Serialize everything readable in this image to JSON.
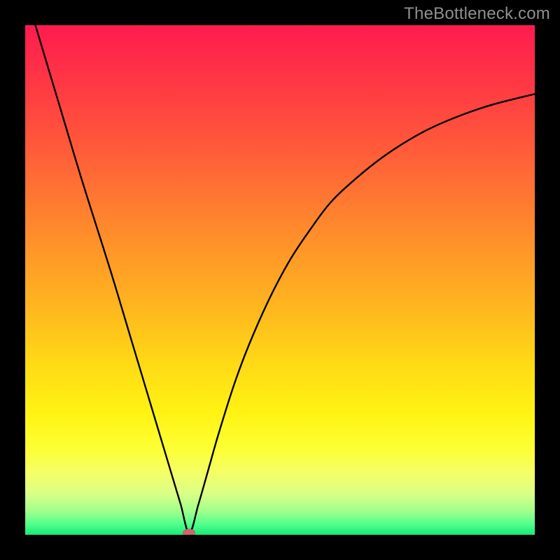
{
  "watermark": "TheBottleneck.com",
  "colors": {
    "frame": "#000000",
    "curve": "#000000",
    "marker": "#d0646e",
    "gradient_stops": [
      {
        "offset": 0.0,
        "color": "#ff1b4f"
      },
      {
        "offset": 0.1,
        "color": "#ff3445"
      },
      {
        "offset": 0.24,
        "color": "#ff5a3a"
      },
      {
        "offset": 0.4,
        "color": "#ff8a2c"
      },
      {
        "offset": 0.55,
        "color": "#ffb51f"
      },
      {
        "offset": 0.66,
        "color": "#ffd816"
      },
      {
        "offset": 0.76,
        "color": "#fff313"
      },
      {
        "offset": 0.83,
        "color": "#fdff33"
      },
      {
        "offset": 0.88,
        "color": "#f4ff68"
      },
      {
        "offset": 0.92,
        "color": "#d9ff86"
      },
      {
        "offset": 0.955,
        "color": "#9dff8c"
      },
      {
        "offset": 0.98,
        "color": "#4fff8c"
      },
      {
        "offset": 1.0,
        "color": "#18e876"
      }
    ]
  },
  "chart_data": {
    "type": "line",
    "title": "",
    "xlabel": "",
    "ylabel": "",
    "xlim": [
      0,
      1
    ],
    "ylim": [
      0,
      1
    ],
    "legend": false,
    "grid": false,
    "marker": {
      "x": 0.322,
      "y": 0.004
    },
    "series": [
      {
        "name": "bottleneck-curve",
        "x": [
          0.02,
          0.05,
          0.08,
          0.11,
          0.14,
          0.17,
          0.2,
          0.23,
          0.26,
          0.29,
          0.305,
          0.322,
          0.34,
          0.36,
          0.38,
          0.41,
          0.44,
          0.48,
          0.52,
          0.56,
          0.6,
          0.65,
          0.7,
          0.75,
          0.8,
          0.86,
          0.92,
          1.0
        ],
        "y": [
          1.0,
          0.9,
          0.8,
          0.7,
          0.605,
          0.51,
          0.41,
          0.31,
          0.21,
          0.11,
          0.06,
          0.004,
          0.06,
          0.13,
          0.2,
          0.295,
          0.375,
          0.465,
          0.54,
          0.6,
          0.653,
          0.7,
          0.74,
          0.773,
          0.8,
          0.825,
          0.845,
          0.865
        ]
      }
    ]
  }
}
